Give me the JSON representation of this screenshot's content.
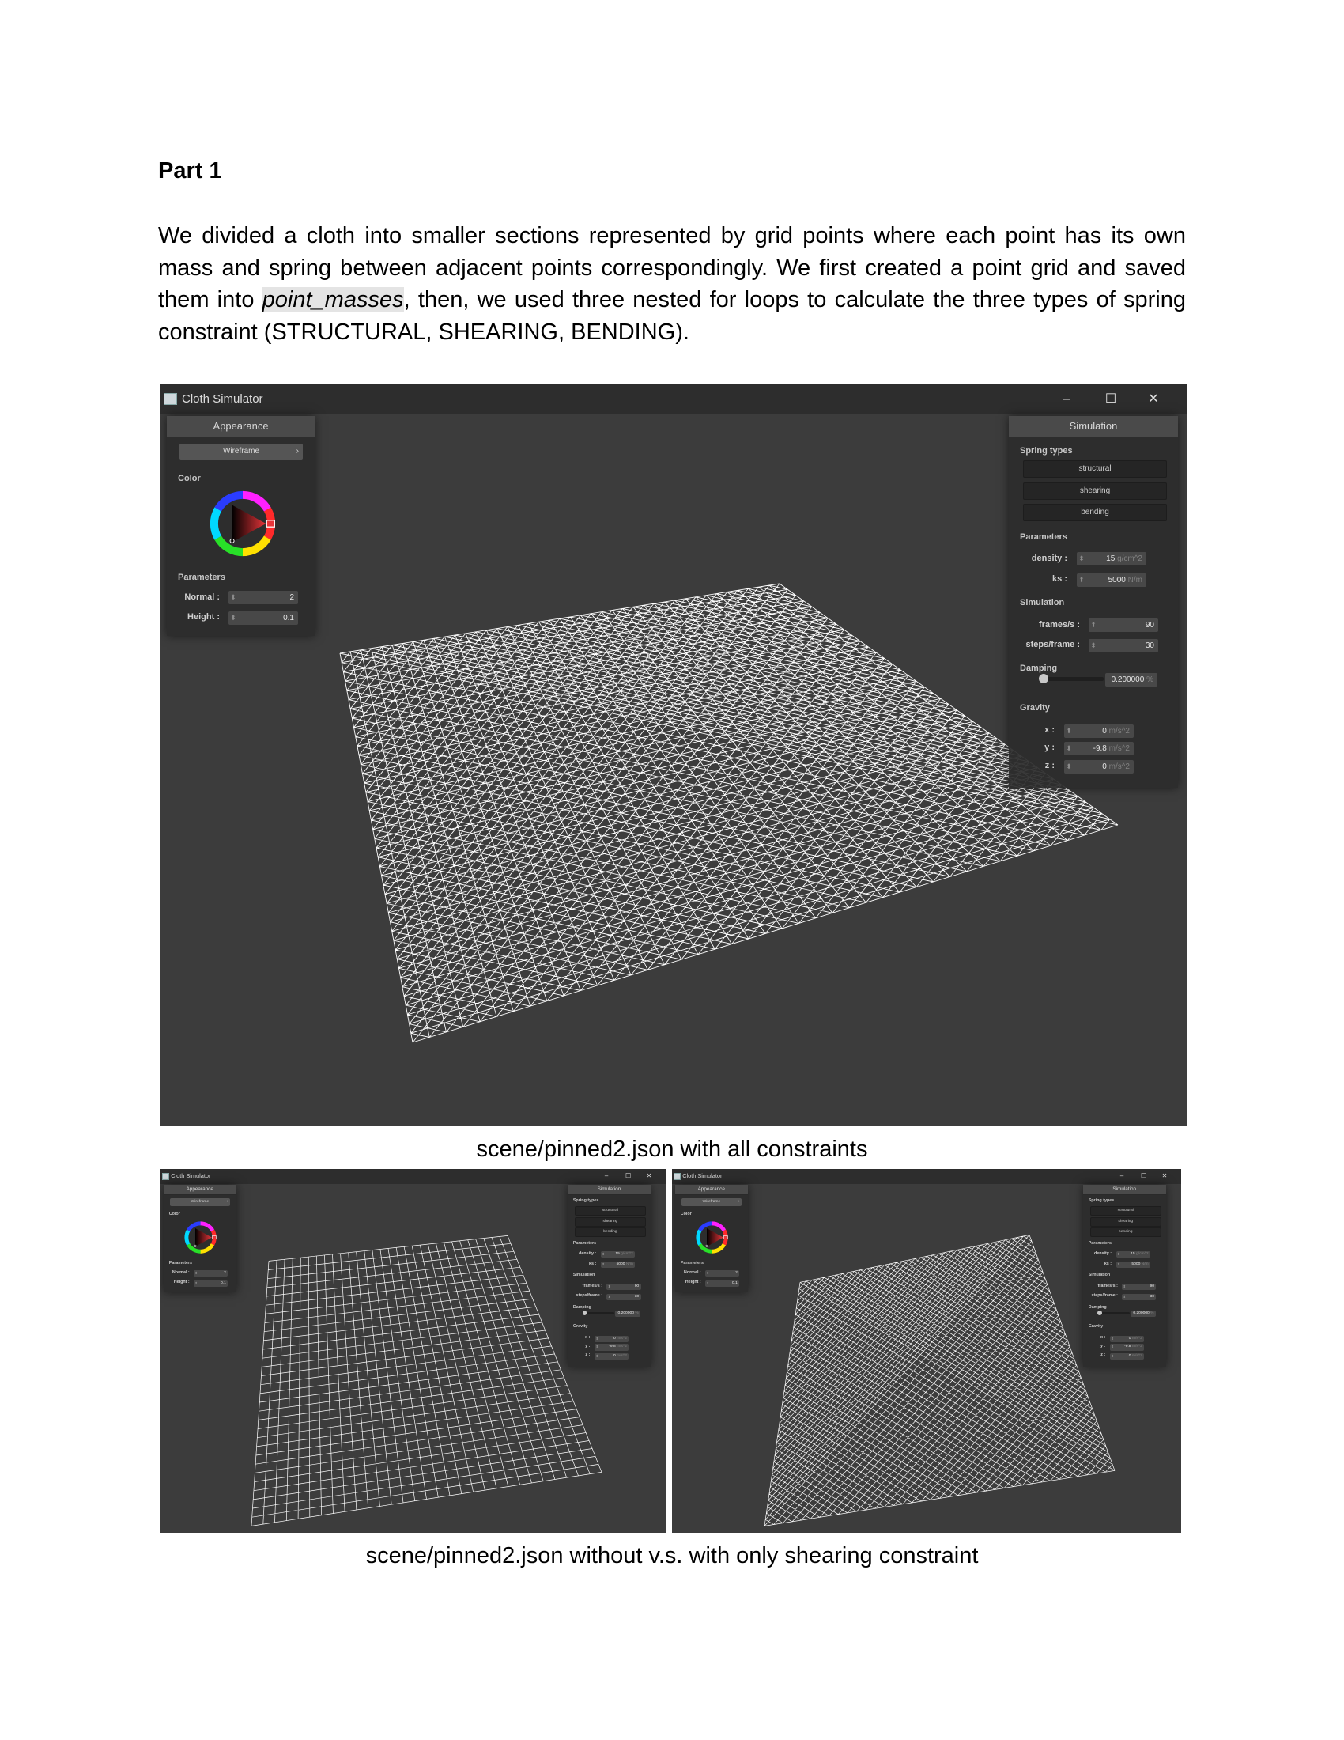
{
  "doc": {
    "heading": "Part 1",
    "para_before": "We divided a cloth into smaller sections represented by grid points where each point has its own mass and spring between adjacent points correspondingly. We first created a point grid and saved them into ",
    "code_term": "point_masses",
    "para_after": ", then, we used three nested for loops to calculate the three types of spring constraint (STRUCTURAL, SHEARING, BENDING).",
    "caption_main": "scene/pinned2.json with all constraints",
    "caption_compare": "scene/pinned2.json without v.s. with only shearing constraint"
  },
  "simulator": {
    "title": "Cloth Simulator",
    "window_controls": [
      "–",
      "☐",
      "✕"
    ],
    "appearance": {
      "title": "Appearance",
      "mode": "Wireframe",
      "mode_chevron": "›",
      "color_label": "Color",
      "params_label": "Parameters",
      "normal_label": "Normal :",
      "normal_value": "2",
      "height_label": "Height :",
      "height_value": "0.1"
    },
    "simulation": {
      "title": "Simulation",
      "spring_types_label": "Spring types",
      "spring_buttons": [
        "structural",
        "shearing",
        "bending"
      ],
      "params_label": "Parameters",
      "density_label": "density :",
      "density_value": "15",
      "density_unit": "g/cm^2",
      "ks_label": "ks :",
      "ks_value": "5000",
      "ks_unit": "N/m",
      "sim_label": "Simulation",
      "fps_label": "frames/s :",
      "fps_value": "90",
      "spf_label": "steps/frame :",
      "spf_value": "30",
      "damping_label": "Damping",
      "damping_value": "0.200000",
      "damping_unit": "%",
      "gravity_label": "Gravity",
      "gx_label": "x :",
      "gx_value": "0",
      "gy_label": "y :",
      "gy_value": "-9.8",
      "gz_label": "z :",
      "gz_value": "0",
      "gravity_unit": "m/s^2",
      "spin_glyph": "⬍"
    }
  },
  "colors": {
    "window_bg": "#3c3c3c",
    "titlebar_bg": "#2d2d2d",
    "panel_bg": "#2c2c2c",
    "wireframe": "#ffffff",
    "wheel_marker": "#e8353a"
  },
  "icons": {
    "app": "cloth-simulator-app-icon",
    "minimize": "minimize-icon",
    "maximize": "maximize-icon",
    "close": "close-icon",
    "color_wheel": "color-wheel-icon"
  }
}
